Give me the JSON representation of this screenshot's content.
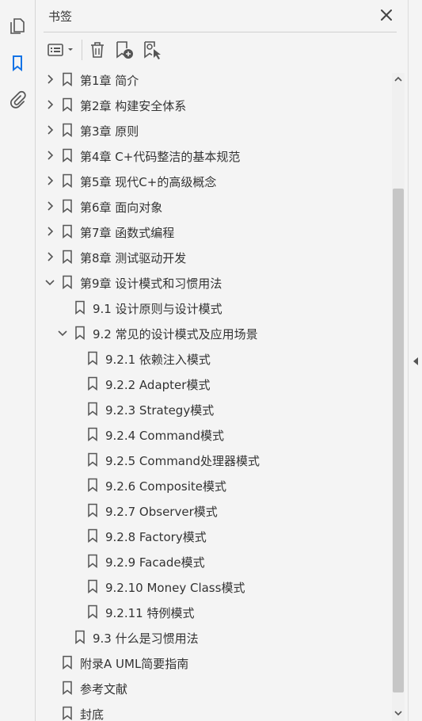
{
  "panel": {
    "title": "书签"
  },
  "left_rail": {
    "items": [
      {
        "icon": "page-thumbnails-icon"
      },
      {
        "icon": "bookmark-icon",
        "active": true
      },
      {
        "icon": "paperclip-icon"
      }
    ]
  },
  "toolbar": {
    "buttons": [
      {
        "icon": "options-menu-icon"
      },
      {
        "icon": "delete-trash-icon"
      },
      {
        "icon": "add-bookmark-icon"
      },
      {
        "icon": "find-bookmark-icon"
      }
    ]
  },
  "bookmarks": [
    {
      "label": "第1章 简介",
      "level": 0,
      "chevron": "right"
    },
    {
      "label": "第2章 构建安全体系",
      "level": 0,
      "chevron": "right"
    },
    {
      "label": "第3章 原则",
      "level": 0,
      "chevron": "right"
    },
    {
      "label": "第4章 C+代码整洁的基本规范",
      "level": 0,
      "chevron": "right"
    },
    {
      "label": "第5章 现代C+的高级概念",
      "level": 0,
      "chevron": "right"
    },
    {
      "label": "第6章 面向对象",
      "level": 0,
      "chevron": "right"
    },
    {
      "label": "第7章 函数式编程",
      "level": 0,
      "chevron": "right"
    },
    {
      "label": "第8章 测试驱动开发",
      "level": 0,
      "chevron": "right"
    },
    {
      "label": "第9章 设计模式和习惯用法",
      "level": 0,
      "chevron": "down"
    },
    {
      "label": "9.1 设计原则与设计模式",
      "level": 1,
      "chevron": "none"
    },
    {
      "label": "9.2 常见的设计模式及应用场景",
      "level": 1,
      "chevron": "down"
    },
    {
      "label": "9.2.1 依赖注入模式",
      "level": 2,
      "chevron": "none"
    },
    {
      "label": "9.2.2 Adapter模式",
      "level": 2,
      "chevron": "none"
    },
    {
      "label": "9.2.3 Strategy模式",
      "level": 2,
      "chevron": "none"
    },
    {
      "label": "9.2.4 Command模式",
      "level": 2,
      "chevron": "none"
    },
    {
      "label": "9.2.5 Command处理器模式",
      "level": 2,
      "chevron": "none"
    },
    {
      "label": "9.2.6 Composite模式",
      "level": 2,
      "chevron": "none"
    },
    {
      "label": "9.2.7 Observer模式",
      "level": 2,
      "chevron": "none"
    },
    {
      "label": "9.2.8 Factory模式",
      "level": 2,
      "chevron": "none"
    },
    {
      "label": "9.2.9 Facade模式",
      "level": 2,
      "chevron": "none"
    },
    {
      "label": "9.2.10 Money Class模式",
      "level": 2,
      "chevron": "none"
    },
    {
      "label": "9.2.11 特例模式",
      "level": 2,
      "chevron": "none"
    },
    {
      "label": "9.3 什么是习惯用法",
      "level": 1,
      "chevron": "none"
    },
    {
      "label": "附录A UML简要指南",
      "level": 0,
      "chevron": "none"
    },
    {
      "label": "参考文献",
      "level": 0,
      "chevron": "none"
    },
    {
      "label": "封底",
      "level": 0,
      "chevron": "none"
    }
  ],
  "colors": {
    "accent": "#1473e6",
    "icon": "#555555",
    "text": "#333333",
    "background": "#f4f4f4"
  }
}
